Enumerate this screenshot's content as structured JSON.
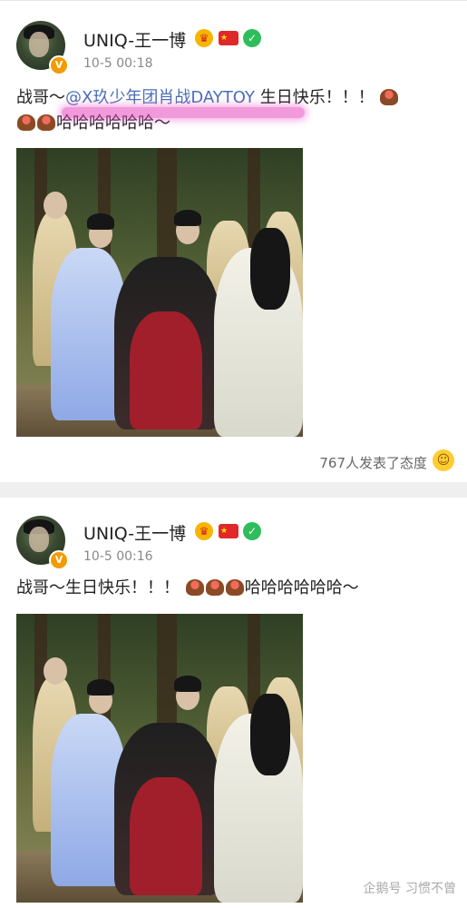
{
  "posts": [
    {
      "username": "UNIQ-王一博",
      "time": "10-5 00:18",
      "text_prefix": "战哥～",
      "mention": "@X玖少年团肖战DAYTOY",
      "text_middle": " 生日快乐！！！",
      "text_suffix": "哈哈哈哈哈哈～",
      "reactions": "767人发表了态度",
      "verified_badge": "V"
    },
    {
      "username": "UNIQ-王一博",
      "time": "10-5 00:16",
      "text_prefix": "战哥～生日快乐！！！",
      "text_suffix": "哈哈哈哈哈哈～",
      "verified_badge": "V"
    }
  ],
  "watermark": "企鹅号 习惯不曾",
  "colors": {
    "mention": "#4a6fb8",
    "highlight": "#e846be",
    "verified": "#f59a00"
  },
  "icons": [
    "crown-icon",
    "china-flag-icon",
    "check-circle-icon",
    "cake-emoji-icon",
    "smile-emoji-icon"
  ]
}
